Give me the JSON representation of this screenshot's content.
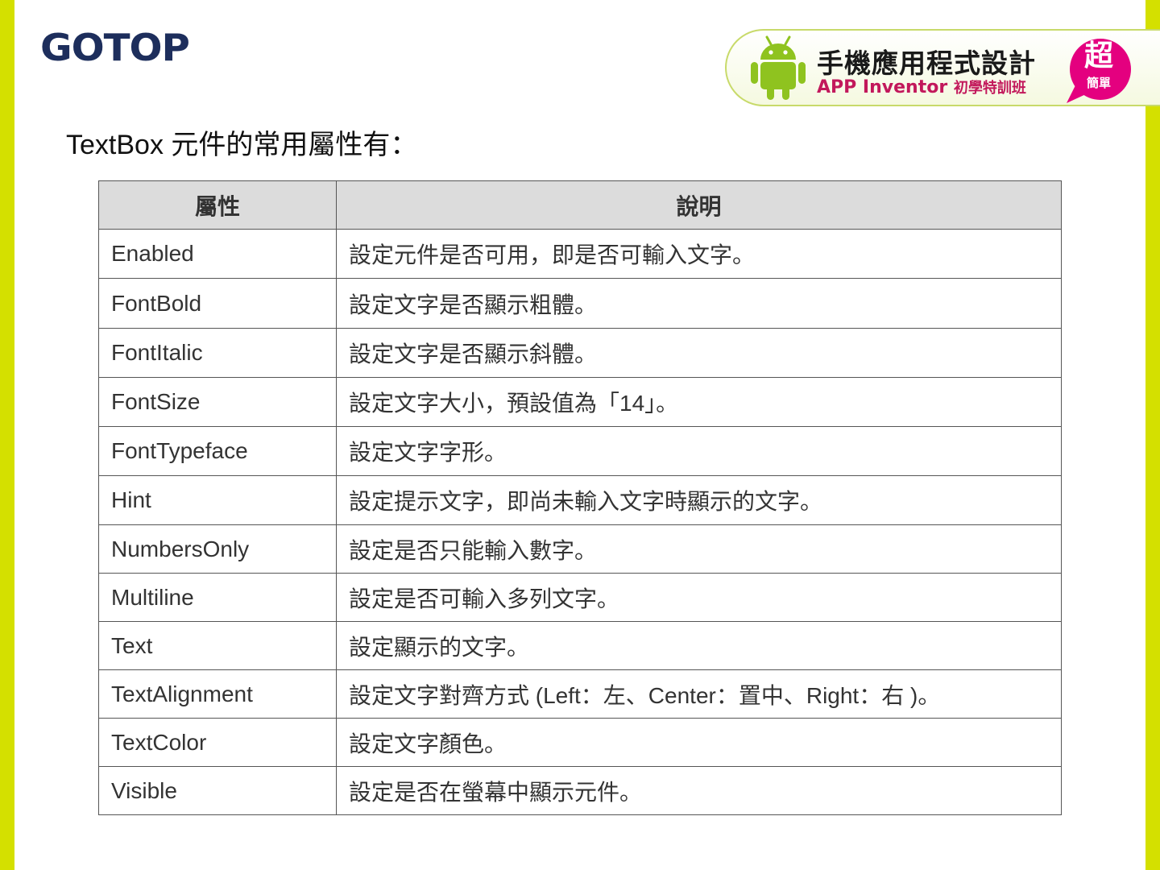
{
  "header": {
    "logo_text": "GOTOP",
    "banner_title": "手機應用程式設計",
    "banner_subtitle_en": "APP Inventor",
    "banner_subtitle_zh": "初學特訓班",
    "badge_main": "超",
    "badge_sub": "簡單"
  },
  "slide": {
    "heading": "TextBox  元件的常用屬性有："
  },
  "table": {
    "headers": [
      "屬性",
      "說明"
    ],
    "rows": [
      {
        "property": "Enabled",
        "description": "設定元件是否可用，即是否可輸入文字。"
      },
      {
        "property": "FontBold",
        "description": "設定文字是否顯示粗體。"
      },
      {
        "property": "FontItalic",
        "description": "設定文字是否顯示斜體。"
      },
      {
        "property": "FontSize",
        "description": "設定文字大小，預設值為「14」。"
      },
      {
        "property": "FontTypeface",
        "description": "設定文字字形。"
      },
      {
        "property": "Hint",
        "description": "設定提示文字，即尚未輸入文字時顯示的文字。"
      },
      {
        "property": "NumbersOnly",
        "description": "設定是否只能輸入數字。"
      },
      {
        "property": "Multiline",
        "description": "設定是否可輸入多列文字。"
      },
      {
        "property": "Text",
        "description": "設定顯示的文字。"
      },
      {
        "property": "TextAlignment",
        "description": "設定文字對齊方式 (Left：左、Center：置中、Right：右 )。"
      },
      {
        "property": "TextColor",
        "description": "設定文字顏色。"
      },
      {
        "property": "Visible",
        "description": "設定是否在螢幕中顯示元件。"
      }
    ]
  },
  "colors": {
    "side_bar": "#d4e000",
    "header_fill": "#dcdcdc",
    "logo": "#1d2e5c",
    "android": "#8fc31f",
    "badge": "#e4007f"
  },
  "icons": {
    "android": "android-robot-icon",
    "badge": "speech-badge-icon"
  }
}
